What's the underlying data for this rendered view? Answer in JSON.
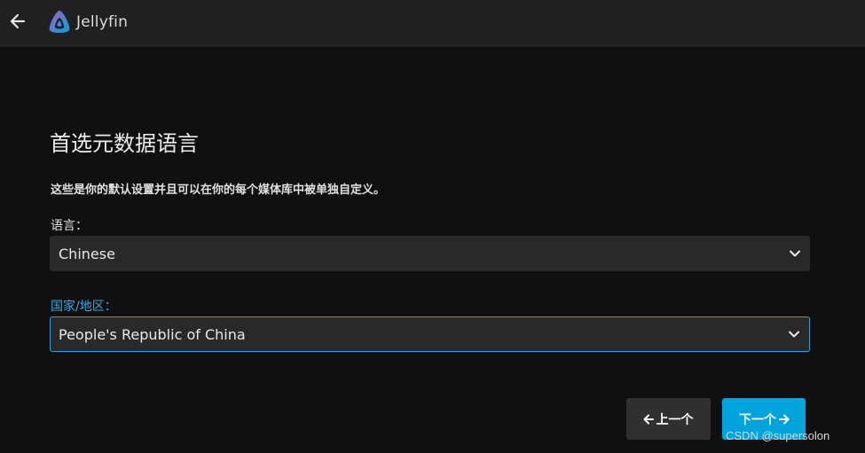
{
  "header": {
    "app_name": "Jellyfin"
  },
  "page": {
    "title": "首选元数据语言",
    "description": "这些是你的默认设置并且可以在你的每个媒体库中被单独自定义。"
  },
  "fields": {
    "language": {
      "label": "语言：",
      "value": "Chinese"
    },
    "country": {
      "label": "国家/地区：",
      "value": "People's Republic of China"
    }
  },
  "buttons": {
    "previous": "上一个",
    "next": "下一个"
  },
  "watermark": "CSDN @supersolon",
  "colors": {
    "accent": "#00a4dc",
    "focus_border": "#2e9fda",
    "background": "#101010",
    "header": "#202020"
  }
}
